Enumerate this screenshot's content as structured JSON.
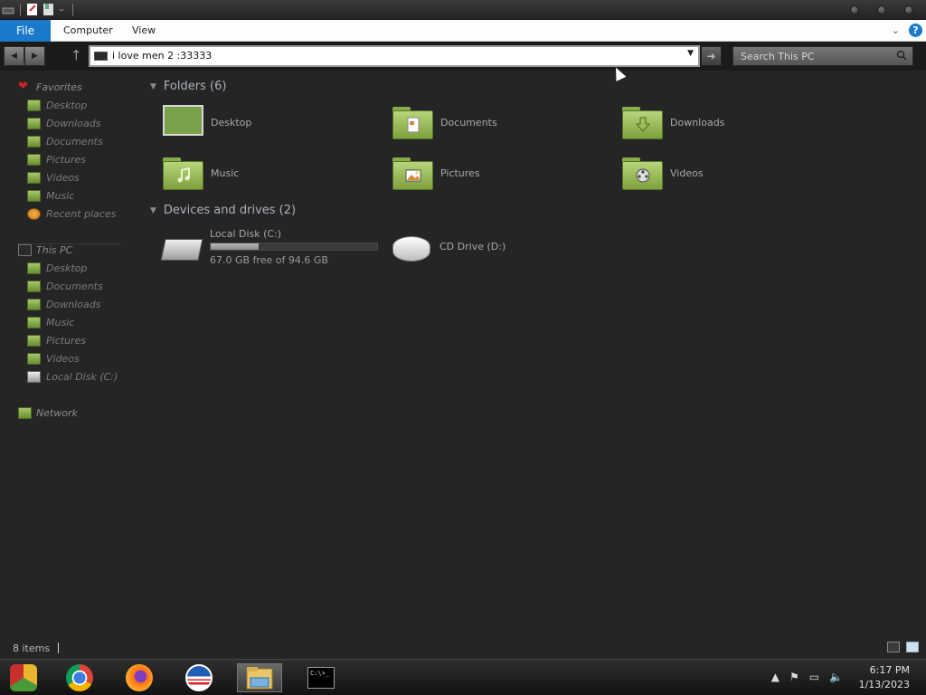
{
  "ribbon": {
    "tabs": [
      "File",
      "Computer",
      "View"
    ]
  },
  "address": {
    "path": "i love men 2 :33333"
  },
  "search": {
    "placeholder": "Search This PC"
  },
  "sidebar": {
    "favorites_label": "Favorites",
    "favorites": [
      "Desktop",
      "Downloads",
      "Documents",
      "Pictures",
      "Videos",
      "Music",
      "Recent places"
    ],
    "thispc_label": "This PC",
    "thispc": [
      "Desktop",
      "Documents",
      "Downloads",
      "Music",
      "Pictures",
      "Videos",
      "Local Disk (C:)"
    ],
    "network_label": "Network"
  },
  "main": {
    "folders_header": "Folders (6)",
    "folders": [
      "Desktop",
      "Documents",
      "Downloads",
      "Music",
      "Pictures",
      "Videos"
    ],
    "devices_header": "Devices and drives (2)",
    "drives": [
      {
        "name": "Local Disk (C:)",
        "free": "67.0 GB free of 94.6 GB",
        "used_fraction": 0.29
      },
      {
        "name": "CD Drive (D:)"
      }
    ]
  },
  "statusbar": {
    "count": "8 items"
  },
  "taskbar": {
    "apps": [
      "chrome-canary-icon",
      "chrome-icon",
      "firefox-icon",
      "obama-logo-icon",
      "file-explorer-icon",
      "command-prompt-icon"
    ],
    "cmd_text": "C:\\>_",
    "time": "6:17 PM",
    "date": "1/13/2023"
  },
  "colors": {
    "file_tab": "#1979ca",
    "folder_green": "#8fb24f",
    "background": "#252525"
  }
}
